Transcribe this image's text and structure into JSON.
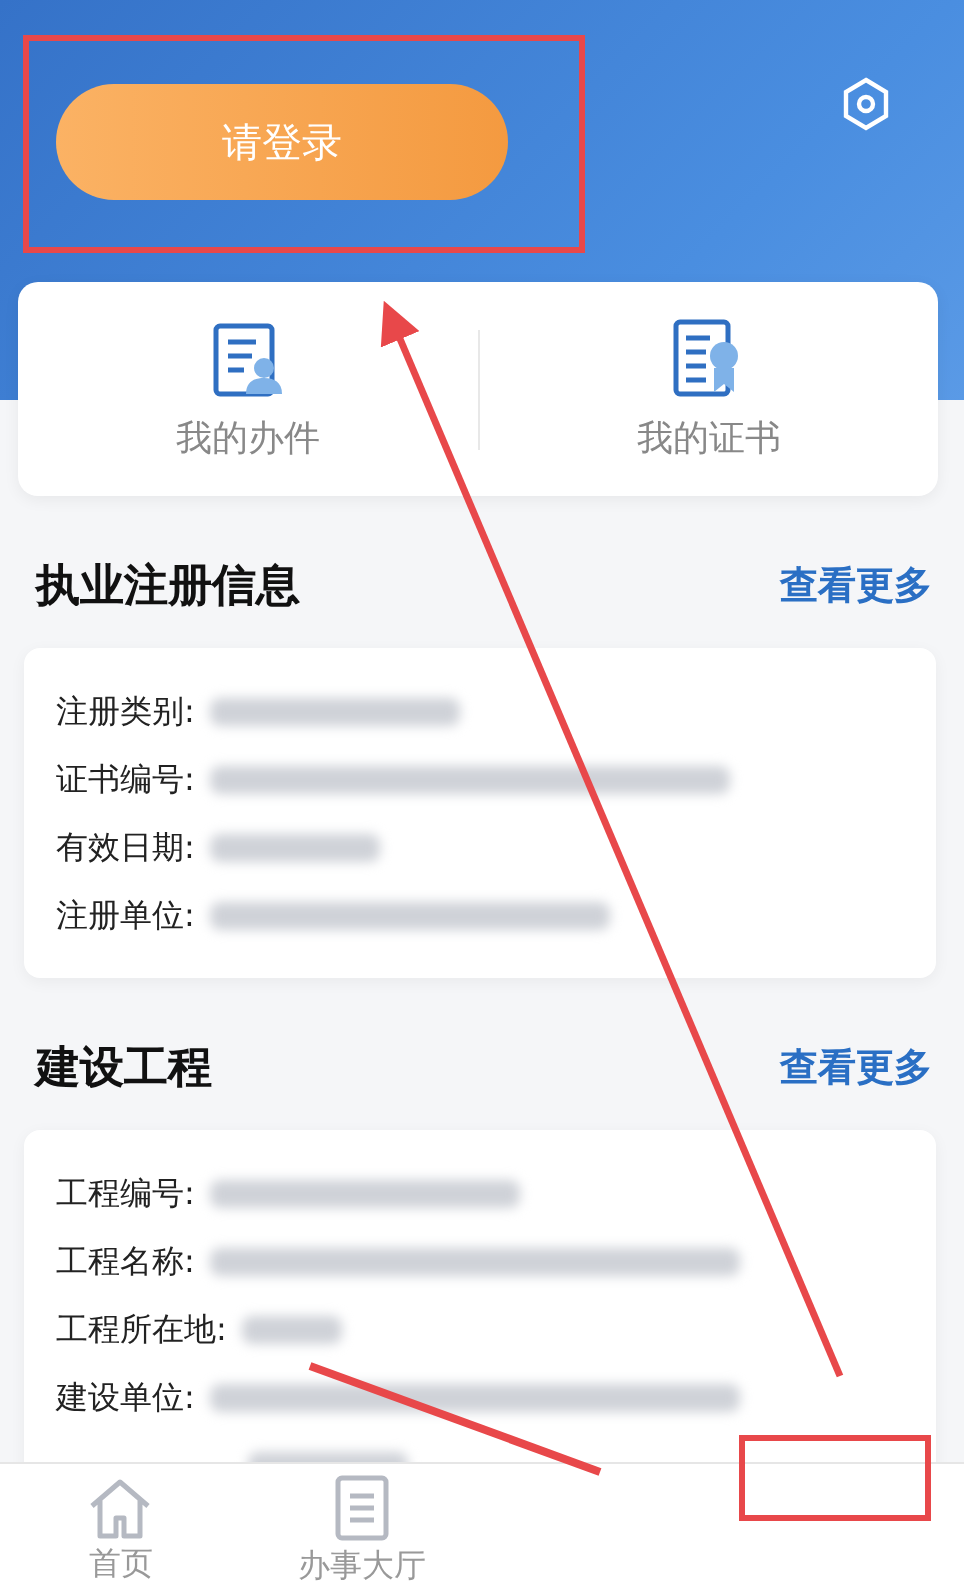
{
  "header": {
    "login_button": "请登录"
  },
  "shortcuts": [
    {
      "label": "我的办件",
      "kind": "tasks"
    },
    {
      "label": "我的证书",
      "kind": "certificate"
    }
  ],
  "sections": [
    {
      "title": "执业注册信息",
      "more": "查看更多",
      "fields": [
        {
          "label": "注册类别:"
        },
        {
          "label": "证书编号:"
        },
        {
          "label": "有效日期:"
        },
        {
          "label": "注册单位:"
        }
      ]
    },
    {
      "title": "建设工程",
      "more": "查看更多",
      "fields": [
        {
          "label": "工程编号:"
        },
        {
          "label": "工程名称:"
        },
        {
          "label": "工程所在地:"
        },
        {
          "label": "建设单位:"
        }
      ]
    }
  ],
  "nav": [
    {
      "label": "首页",
      "kind": "home"
    },
    {
      "label": "办事大厅",
      "kind": "hall"
    }
  ]
}
